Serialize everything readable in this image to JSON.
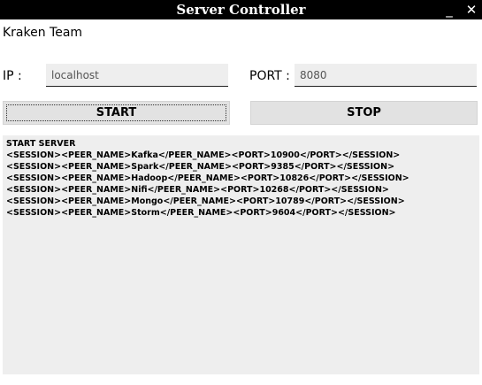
{
  "window": {
    "title": "Server Controller",
    "minimize_glyph": "_",
    "close_glyph": "✕"
  },
  "team_label": "Kraken Team",
  "ip": {
    "label": "IP :",
    "value": "localhost"
  },
  "port": {
    "label": "PORT :",
    "value": "8080"
  },
  "buttons": {
    "start_label": "START",
    "stop_label": "STOP"
  },
  "log": {
    "lines": [
      "START SERVER",
      "<SESSION><PEER_NAME>Kafka</PEER_NAME><PORT>10900</PORT></SESSION>",
      "<SESSION><PEER_NAME>Spark</PEER_NAME><PORT>9385</PORT></SESSION>",
      "<SESSION><PEER_NAME>Hadoop</PEER_NAME><PORT>10826</PORT></SESSION>",
      "<SESSION><PEER_NAME>Nifi</PEER_NAME><PORT>10268</PORT></SESSION>",
      "<SESSION><PEER_NAME>Mongo</PEER_NAME><PORT>10789</PORT></SESSION>",
      "<SESSION><PEER_NAME>Storm</PEER_NAME><PORT>9604</PORT></SESSION>"
    ]
  }
}
